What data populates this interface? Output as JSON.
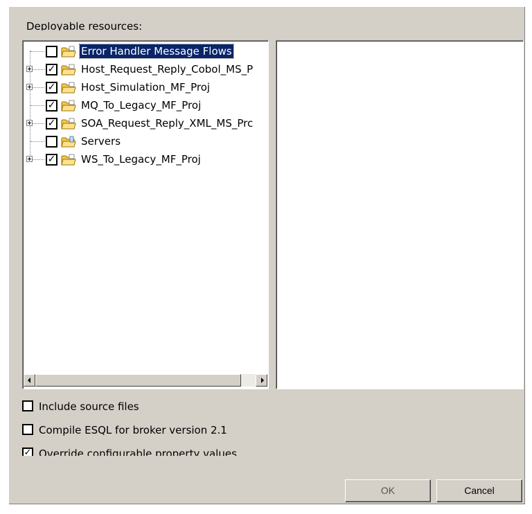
{
  "section_label": "Deployable resources:",
  "tree": {
    "items": [
      {
        "label": "Error Handler Message Flows",
        "checked": false,
        "expandable": false,
        "selected": true,
        "icon": "project-folder-icon"
      },
      {
        "label": "Host_Request_Reply_Cobol_MS_P",
        "checked": true,
        "expandable": true,
        "selected": false,
        "icon": "project-folder-icon"
      },
      {
        "label": "Host_Simulation_MF_Proj",
        "checked": true,
        "expandable": true,
        "selected": false,
        "icon": "project-folder-icon"
      },
      {
        "label": "MQ_To_Legacy_MF_Proj",
        "checked": true,
        "expandable": false,
        "selected": false,
        "icon": "project-folder-icon"
      },
      {
        "label": "SOA_Request_Reply_XML_MS_Prc",
        "checked": true,
        "expandable": true,
        "selected": false,
        "icon": "project-folder-icon"
      },
      {
        "label": "Servers",
        "checked": false,
        "expandable": false,
        "selected": false,
        "icon": "servers-folder-icon"
      },
      {
        "label": "WS_To_Legacy_MF_Proj",
        "checked": true,
        "expandable": true,
        "selected": false,
        "icon": "project-folder-icon"
      }
    ]
  },
  "options": {
    "include_source": {
      "label": "Include source files",
      "checked": false
    },
    "compile_esql": {
      "label": "Compile ESQL for broker version 2.1",
      "checked": false
    },
    "override_props": {
      "label": "Override configurable property values",
      "checked": true
    }
  },
  "buttons": {
    "ok": "OK",
    "cancel": "Cancel"
  },
  "icons": {
    "scroll_left": "scroll-left-arrow-icon",
    "scroll_right": "scroll-right-arrow-icon",
    "expand": "expand-plus-icon"
  },
  "colors": {
    "selection": "#0a246a",
    "dialog_bg": "#d4d0c8"
  }
}
